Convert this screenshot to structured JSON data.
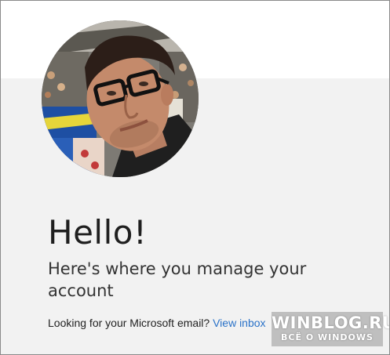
{
  "profile": {
    "avatar_icon": "profile-photo"
  },
  "greeting": {
    "title": "Hello!",
    "subtitle": "Here's where you manage your account"
  },
  "email_prompt": {
    "text": "Looking for your Microsoft email?",
    "link_label": "View inbox"
  },
  "watermark": {
    "main": "WINBLOG.RU",
    "sub": "ВСЁ О WINDOWS"
  },
  "colors": {
    "panel_background": "#f2f2f2",
    "link": "#2a72c8",
    "text": "#1f1f1f"
  }
}
